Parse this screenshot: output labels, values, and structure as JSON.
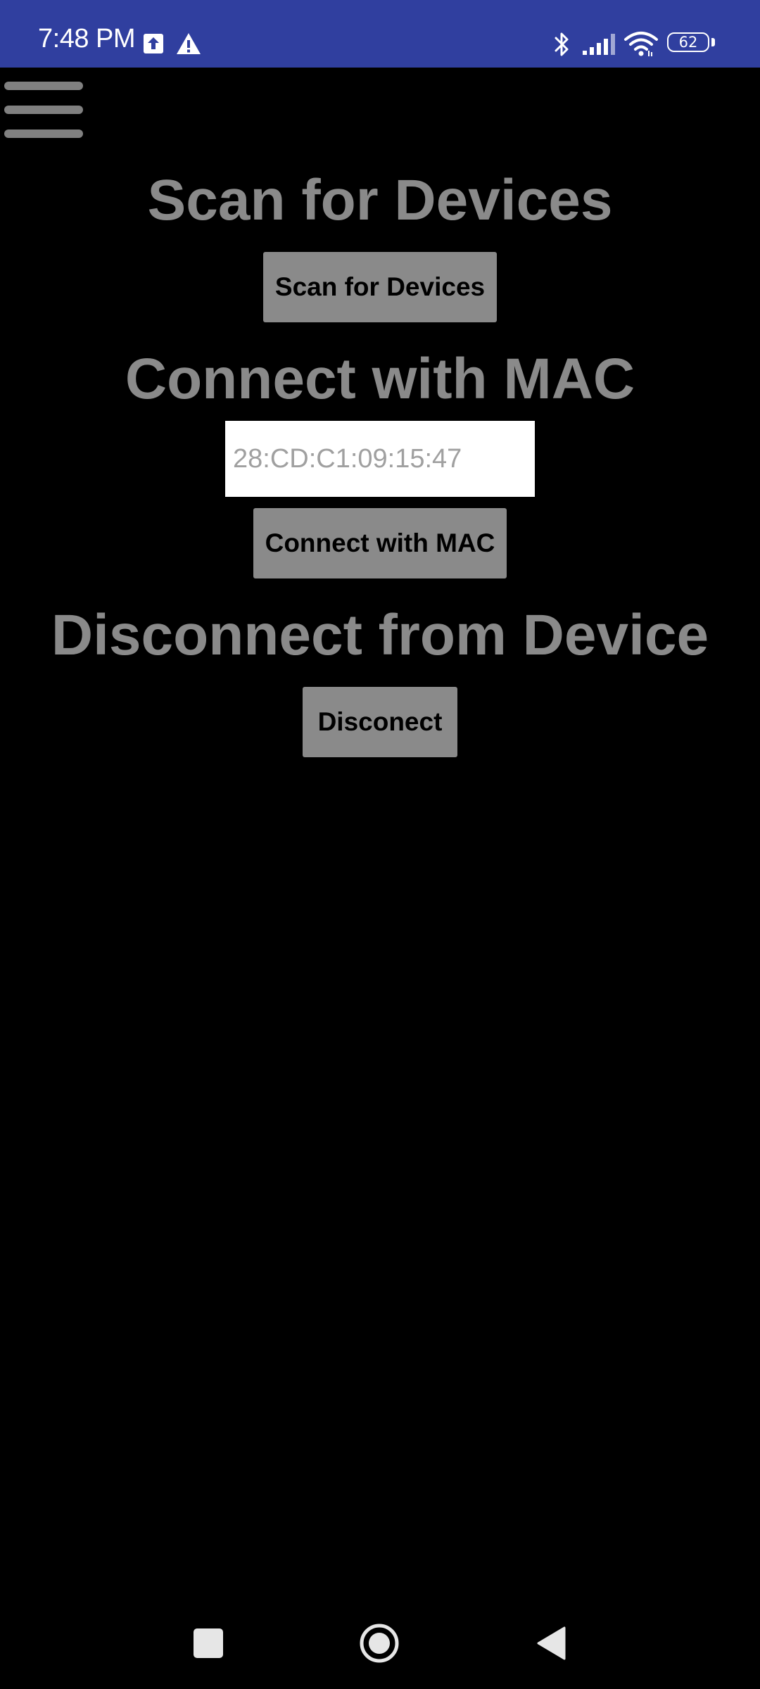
{
  "status_bar": {
    "time": "7:48 PM",
    "battery_level": "62",
    "icons": [
      "upload-icon",
      "alert-icon",
      "bluetooth-icon",
      "signal-icon",
      "wifi-icon",
      "battery-icon"
    ],
    "background_color": "#303F9F"
  },
  "menu": {
    "icon": "hamburger-menu-icon"
  },
  "scan_section": {
    "heading": "Scan for Devices",
    "button_label": "Scan for Devices"
  },
  "connect_section": {
    "heading": "Connect with MAC",
    "mac_input_value": "28:CD:C1:09:15:47",
    "button_label": "Connect with MAC"
  },
  "disconnect_section": {
    "heading": "Disconnect from Device",
    "button_label": "Disconect"
  },
  "nav_bar": {
    "icons": [
      "recents-icon",
      "home-icon",
      "back-icon"
    ]
  },
  "colors": {
    "background": "#000000",
    "heading_text": "#8a8a8a",
    "button_fill": "#8a8a8a",
    "button_text": "#000000",
    "input_fill": "#ffffff"
  }
}
